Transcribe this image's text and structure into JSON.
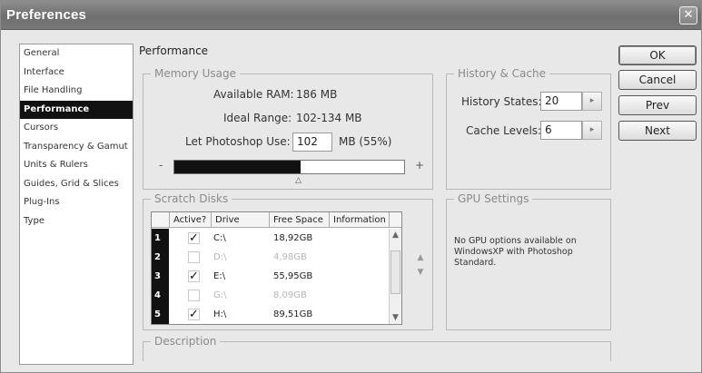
{
  "window": {
    "title": "Preferences",
    "close_label": "✕"
  },
  "sidebar": {
    "items": [
      {
        "label": "General"
      },
      {
        "label": "Interface"
      },
      {
        "label": "File Handling"
      },
      {
        "label": "Performance"
      },
      {
        "label": "Cursors"
      },
      {
        "label": "Transparency & Gamut"
      },
      {
        "label": "Units & Rulers"
      },
      {
        "label": "Guides, Grid & Slices"
      },
      {
        "label": "Plug-Ins"
      },
      {
        "label": "Type"
      }
    ],
    "selected_index": 3
  },
  "section_title": "Performance",
  "memory": {
    "legend": "Memory Usage",
    "available_label": "Available RAM:",
    "available_value": "186 MB",
    "ideal_label": "Ideal Range:",
    "ideal_value": "102-134 MB",
    "use_label": "Let Photoshop Use:",
    "use_value": "102",
    "use_suffix": "MB (55%)",
    "minus": "-",
    "plus": "+",
    "usage_fraction": 0.55
  },
  "history": {
    "legend": "History & Cache",
    "states_label": "History States:",
    "states_value": "20",
    "cache_label": "Cache Levels:",
    "cache_value": "6",
    "spin_glyph": "▸"
  },
  "scratch": {
    "legend": "Scratch Disks",
    "columns": [
      "Active?",
      "Drive",
      "Free Space",
      "Information"
    ],
    "rows": [
      {
        "num": "1",
        "active": true,
        "drive": "C:\\",
        "free": "18,92GB",
        "enabled": true
      },
      {
        "num": "2",
        "active": false,
        "drive": "D:\\",
        "free": "4,98GB",
        "enabled": false
      },
      {
        "num": "3",
        "active": true,
        "drive": "E:\\",
        "free": "55,95GB",
        "enabled": true
      },
      {
        "num": "4",
        "active": false,
        "drive": "G:\\",
        "free": "8,09GB",
        "enabled": false
      },
      {
        "num": "5",
        "active": true,
        "drive": "H:\\",
        "free": "89,51GB",
        "enabled": true
      }
    ],
    "check_glyph": "✓",
    "up_glyph": "▲",
    "down_glyph": "▼"
  },
  "gpu": {
    "legend": "GPU Settings",
    "text": "No GPU options available on WindowsXP with Photoshop Standard."
  },
  "description": {
    "legend": "Description"
  },
  "buttons": {
    "ok": "OK",
    "cancel": "Cancel",
    "prev": "Prev",
    "next": "Next"
  }
}
